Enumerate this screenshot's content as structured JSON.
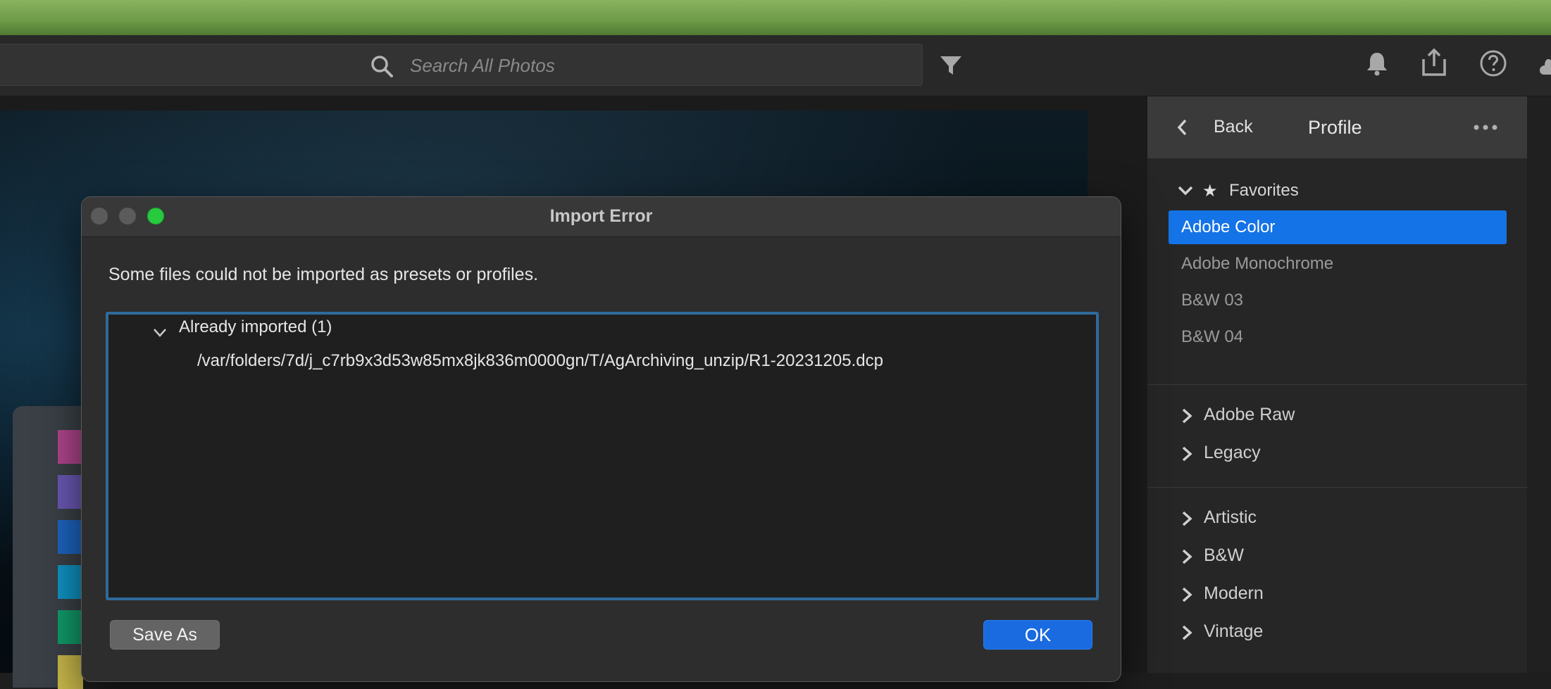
{
  "toolbar": {
    "search_placeholder": "Search All Photos",
    "icons": [
      "search-icon",
      "filter-icon",
      "bell-icon",
      "share-icon",
      "help-icon",
      "cloud-icon"
    ]
  },
  "profile_panel": {
    "back_label": "Back",
    "title": "Profile",
    "favorites": {
      "label": "Favorites",
      "items": [
        {
          "label": "Adobe Color",
          "selected": true
        },
        {
          "label": "Adobe Monochrome",
          "selected": false
        },
        {
          "label": "B&W 03",
          "selected": false
        },
        {
          "label": "B&W 04",
          "selected": false
        }
      ]
    },
    "groups": [
      {
        "label": "Adobe Raw"
      },
      {
        "label": "Legacy"
      },
      {
        "label": "Artistic"
      },
      {
        "label": "B&W"
      },
      {
        "label": "Modern"
      },
      {
        "label": "Vintage"
      }
    ]
  },
  "dialog": {
    "title": "Import Error",
    "message": "Some files could not be imported as presets or profiles.",
    "group_title": "Already imported (1)",
    "files": [
      "/var/folders/7d/j_c7rb9x3d53w85mx8jk836m0000gn/T/AgArchiving_unzip/R1-20231205.dcp"
    ],
    "save_label": "Save As",
    "ok_label": "OK"
  },
  "colors": {
    "accent": "#1473e6",
    "list_border": "#2f6a9c",
    "ok_button": "#1a6ae0",
    "zoom_button": "#27c93f"
  }
}
